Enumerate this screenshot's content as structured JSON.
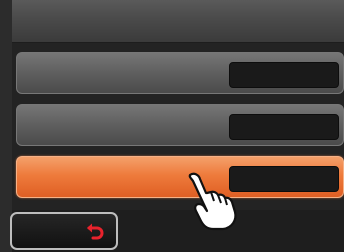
{
  "title": "",
  "menu_rows": [
    {
      "label": "",
      "value": "",
      "selected": false
    },
    {
      "label": "",
      "value": "",
      "selected": false
    },
    {
      "label": "",
      "value": "",
      "selected": true
    }
  ],
  "back_button": {
    "label": "",
    "icon": "return-arrow-icon",
    "icon_color": "#e8222c"
  },
  "pointer": {
    "icon": "pointing-hand-icon"
  },
  "colors": {
    "selected_row": "#ee7b3c",
    "row": "#616161",
    "value_box": "#1a1a1a",
    "background": "#232323"
  }
}
